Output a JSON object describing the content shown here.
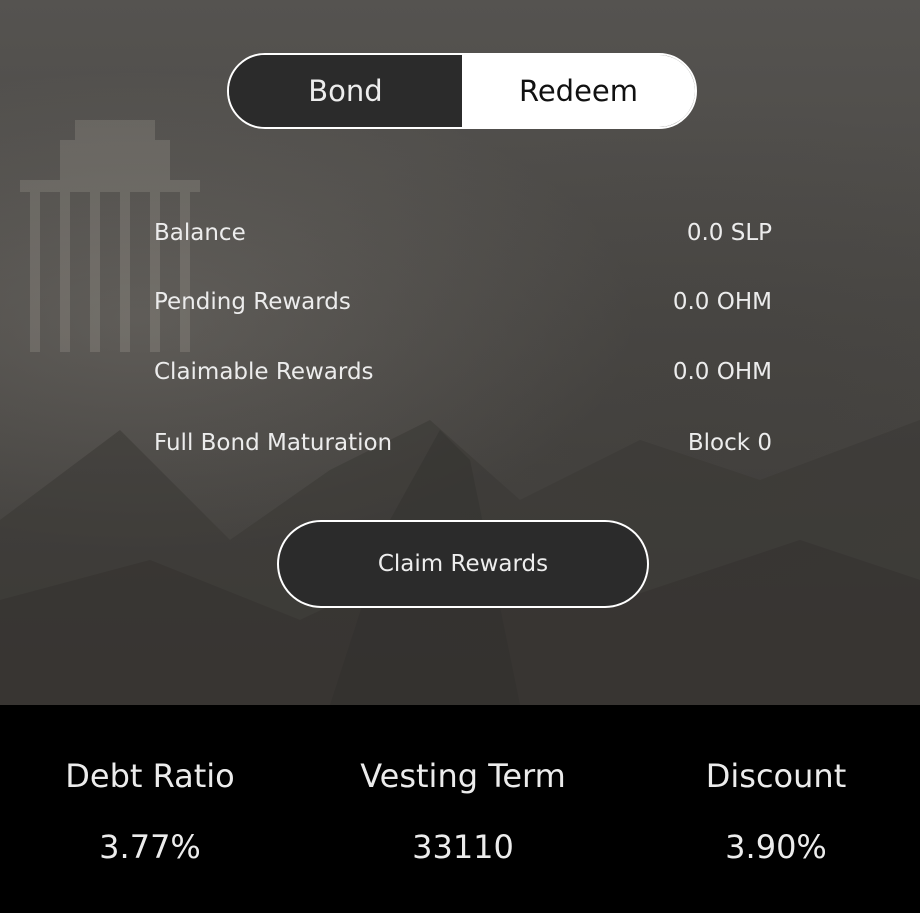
{
  "tabs": {
    "bond_label": "Bond",
    "redeem_label": "Redeem",
    "active": "redeem"
  },
  "redeem_info": {
    "rows": [
      {
        "label": "Balance",
        "value": "0.0 SLP"
      },
      {
        "label": "Pending Rewards",
        "value": "0.0 OHM"
      },
      {
        "label": "Claimable Rewards",
        "value": "0.0 OHM"
      },
      {
        "label": "Full Bond Maturation",
        "value": "Block 0"
      }
    ]
  },
  "claim_button": {
    "label": "Claim Rewards"
  },
  "stats": [
    {
      "label": "Debt Ratio",
      "value": "3.77%"
    },
    {
      "label": "Vesting Term",
      "value": "33110"
    },
    {
      "label": "Discount",
      "value": "3.90%"
    }
  ],
  "colors": {
    "background_dark": "#000000",
    "button_fill": "#2b2b2b",
    "text": "#ececec",
    "selected_tab": "#ffffff"
  }
}
